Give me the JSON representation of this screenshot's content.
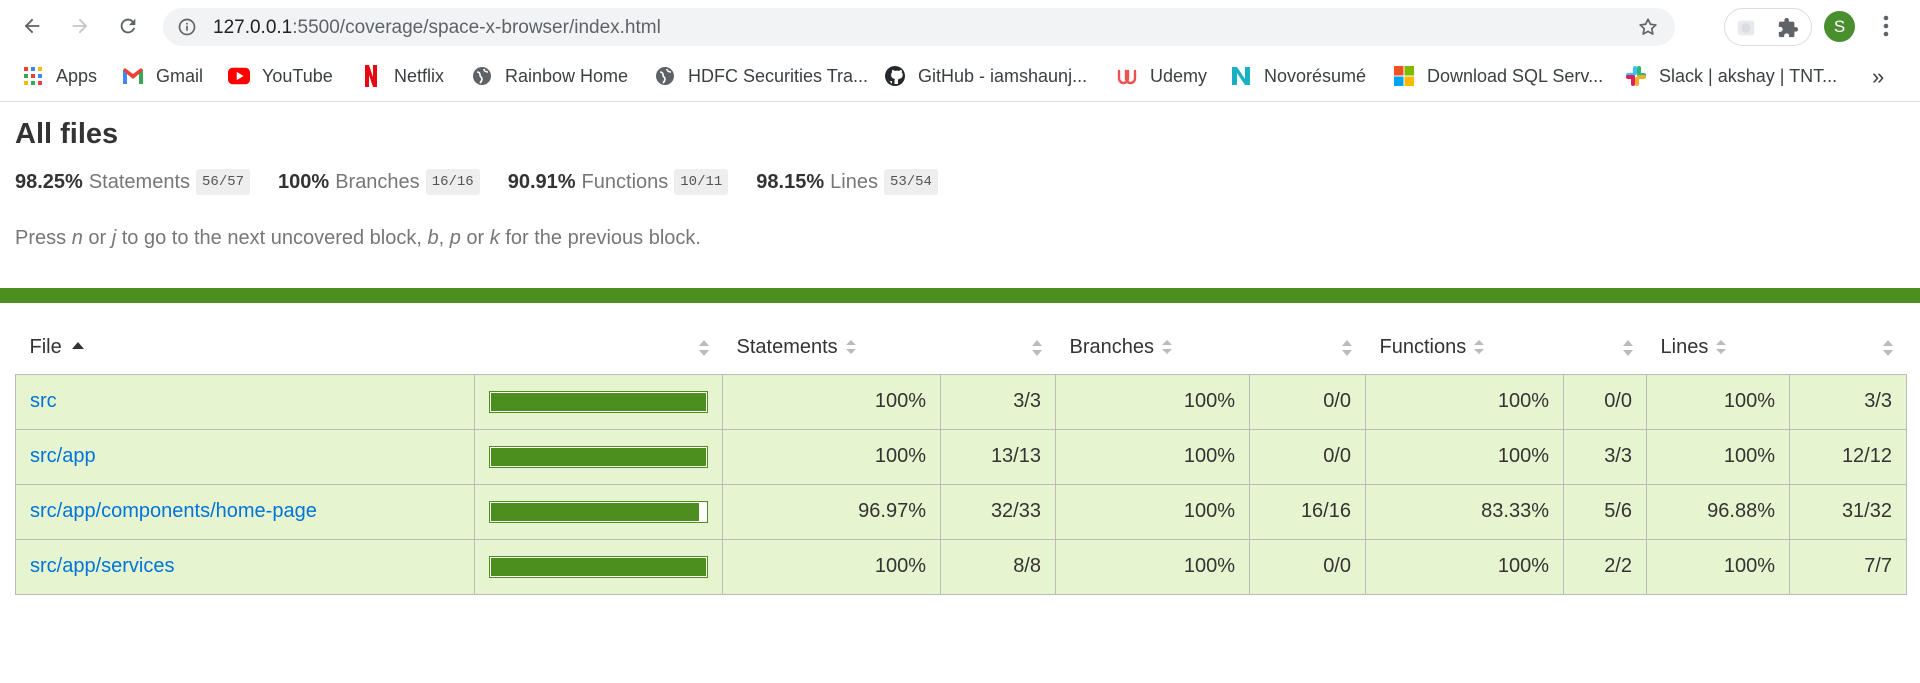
{
  "browser": {
    "url_host": "127.0.0.1",
    "url_path": ":5500/coverage/space-x-browser/index.html",
    "avatar_letter": "S",
    "bookmarks": [
      {
        "label": "Apps",
        "icon": "apps-grid-icon",
        "color": "#1a73e8"
      },
      {
        "label": "Gmail",
        "icon": "gmail-icon",
        "color": "#ea4335"
      },
      {
        "label": "YouTube",
        "icon": "youtube-icon",
        "color": "#ff0000"
      },
      {
        "label": "Netflix",
        "icon": "netflix-icon",
        "color": "#e50914"
      },
      {
        "label": "Rainbow Home",
        "icon": "globe-icon",
        "color": "#5f6368"
      },
      {
        "label": "HDFC Securities Tra...",
        "icon": "globe-icon",
        "color": "#5f6368"
      },
      {
        "label": "GitHub - iamshaunj...",
        "icon": "github-icon",
        "color": "#24292e"
      },
      {
        "label": "Udemy",
        "icon": "udemy-icon",
        "color": "#ec5252"
      },
      {
        "label": "Novorésumé",
        "icon": "novoresume-icon",
        "color": "#1ab0c4"
      },
      {
        "label": "Download SQL Serv...",
        "icon": "microsoft-icon",
        "color": "#f25022"
      },
      {
        "label": "Slack | akshay | TNT...",
        "icon": "slack-icon",
        "color": "#e01e5a"
      }
    ],
    "overflow": "»"
  },
  "page": {
    "title": "All files",
    "summary": [
      {
        "pct": "98.25%",
        "label": "Statements",
        "frac": "56/57"
      },
      {
        "pct": "100%",
        "label": "Branches",
        "frac": "16/16"
      },
      {
        "pct": "90.91%",
        "label": "Functions",
        "frac": "10/11"
      },
      {
        "pct": "98.15%",
        "label": "Lines",
        "frac": "53/54"
      }
    ],
    "hint": {
      "p1": "Press ",
      "k1": "n",
      "p2": " or ",
      "k2": "j",
      "p3": " to go to the next uncovered block, ",
      "k3": "b",
      "p4": ", ",
      "k4": "p",
      "p5": " or ",
      "k5": "k",
      "p6": " for the previous block."
    },
    "status_color": "#4d8f1f"
  },
  "table": {
    "headers": {
      "file": "File",
      "statements": "Statements",
      "branches": "Branches",
      "functions": "Functions",
      "lines": "Lines"
    },
    "rows": [
      {
        "file": "src",
        "coverage": 1.0,
        "stmt_pct": "100%",
        "stmt_frac": "3/3",
        "br_pct": "100%",
        "br_frac": "0/0",
        "fn_pct": "100%",
        "fn_frac": "0/0",
        "ln_pct": "100%",
        "ln_frac": "3/3"
      },
      {
        "file": "src/app",
        "coverage": 1.0,
        "stmt_pct": "100%",
        "stmt_frac": "13/13",
        "br_pct": "100%",
        "br_frac": "0/0",
        "fn_pct": "100%",
        "fn_frac": "3/3",
        "ln_pct": "100%",
        "ln_frac": "12/12"
      },
      {
        "file": "src/app/components/home-page",
        "coverage": 0.9697,
        "stmt_pct": "96.97%",
        "stmt_frac": "32/33",
        "br_pct": "100%",
        "br_frac": "16/16",
        "fn_pct": "83.33%",
        "fn_frac": "5/6",
        "ln_pct": "96.88%",
        "ln_frac": "31/32"
      },
      {
        "file": "src/app/services",
        "coverage": 1.0,
        "stmt_pct": "100%",
        "stmt_frac": "8/8",
        "br_pct": "100%",
        "br_frac": "0/0",
        "fn_pct": "100%",
        "fn_frac": "2/2",
        "ln_pct": "100%",
        "ln_frac": "7/7"
      }
    ]
  }
}
